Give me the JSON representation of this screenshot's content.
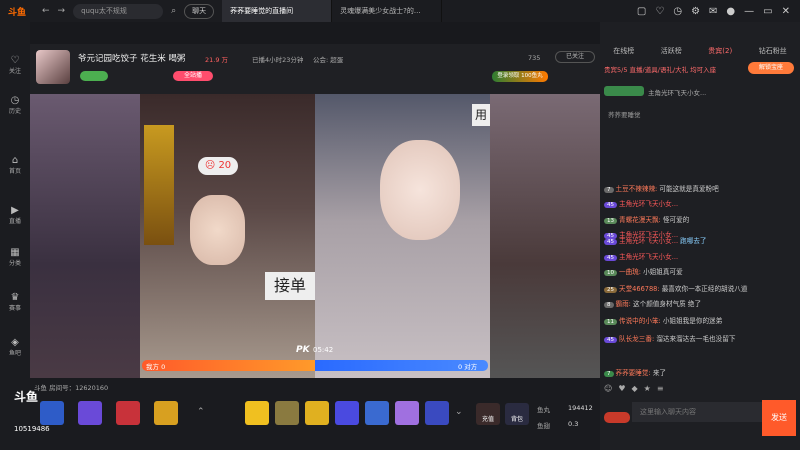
{
  "topbar": {
    "search_placeholder": "ququ太不规规",
    "chat_label": "聊天",
    "tabs": [
      {
        "label": "荞荞要睡觉的直播间",
        "active": true
      },
      {
        "label": "灵魂爆满美少女战士?的...",
        "active": false
      }
    ]
  },
  "sidebar": [
    {
      "label": "关注"
    },
    {
      "label": "历史"
    },
    {
      "label": "首页"
    },
    {
      "label": "直播"
    },
    {
      "label": "分类"
    },
    {
      "label": "赛事"
    },
    {
      "label": "鱼吧"
    }
  ],
  "room": {
    "title": "爷元记园吃饺子 花生米 喝粥",
    "heat": "21.9 万",
    "live_time": "已播4小时23分钟",
    "notice": "公会: 超蛋",
    "fan_count": "735",
    "follow_label": "已关注",
    "station_badge": "全站播",
    "gift_badge": "登录领取 100鱼丸",
    "room_id_label": "斗鱼 房间号：12620160",
    "fan_total": "10519486",
    "stream_text_left": "接单",
    "stream_text_right": "用",
    "like_count": "20"
  },
  "pk": {
    "label": "PK",
    "time": "05:42",
    "our_side": "我方 0",
    "their_side": "0 对方"
  },
  "bottom": {
    "recharge_label": "充值",
    "backpack_label": "背包",
    "yuwan_label": "鱼丸",
    "yuwan_value": "194412",
    "yuchi_label": "鱼翅",
    "yuchi_value": "0.3"
  },
  "right": {
    "tabs": [
      {
        "label": "在线榜",
        "active": false
      },
      {
        "label": "活跃榜",
        "active": false
      },
      {
        "label": "贵宾(2)",
        "active": true
      },
      {
        "label": "钻石粉丝",
        "active": false
      }
    ],
    "notice": "贵宾5/5 直播/道具/语礼/大礼 均可入座",
    "unlock_label": "解锁宝座",
    "host_label": "主角光环飞天小女...",
    "host_sub": "荞荞要睡觉",
    "messages": [
      {
        "level": "7",
        "user": "土豆不辣辣辣:",
        "text": "可能这就是真爱粉吧"
      },
      {
        "level": "45",
        "user": "主角光环飞天小女...",
        "text": ""
      },
      {
        "level": "13",
        "user": "青螺花漫天飘:",
        "text": "怪可爱的"
      },
      {
        "level": "45",
        "user": "主角光环飞天小女...",
        "text": ""
      },
      {
        "level": "45",
        "user": "主角光环飞天小女...",
        "text": "跑哪去了"
      },
      {
        "level": "45",
        "user": "主角光环飞天小女...",
        "text": ""
      },
      {
        "level": "10",
        "user": "一曲琉:",
        "text": "小姐姐真可爱"
      },
      {
        "level": "25",
        "user": "天堂466788:",
        "text": "最喜欢你一本正经的胡说八道"
      },
      {
        "level": "8",
        "user": "霸雨:",
        "text": "这个颜值身材气质 绝了"
      },
      {
        "level": "11",
        "user": "传说中的小笨:",
        "text": "小姐姐我是你的迷弟"
      },
      {
        "level": "45",
        "user": "队长龙三番:",
        "text": "溜达来溜达去一毛也没留下"
      },
      {
        "level": "7",
        "user": "荞荞要睡觉:",
        "text": "来了"
      }
    ],
    "input_placeholder": "这里输入聊天内容",
    "send_label": "发送"
  }
}
